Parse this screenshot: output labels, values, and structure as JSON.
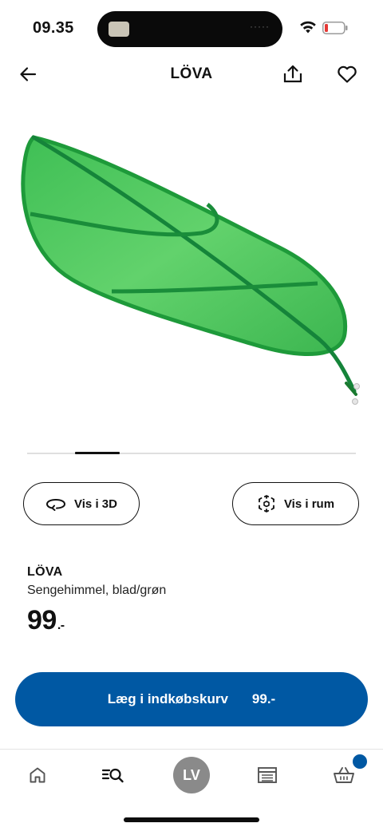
{
  "status_bar": {
    "time": "09.35",
    "icons": [
      "wifi-icon",
      "battery-icon"
    ],
    "battery_color": "#e53935"
  },
  "header": {
    "title": "LÖVA",
    "icons": [
      "arrow-left-icon",
      "share-icon",
      "heart-icon"
    ]
  },
  "product_image": {
    "subject": "green leaf bed canopy",
    "colors": {
      "leaf_light": "#4cc35a",
      "leaf_dark": "#1e9a3a"
    }
  },
  "carousel": {
    "active_index": 1
  },
  "actions": {
    "view_3d_label": "Vis i 3D",
    "view_room_label": "Vis i rum",
    "view_3d_icon": "rotate-3d-icon",
    "view_room_icon": "ar-cube-icon"
  },
  "product": {
    "name": "LÖVA",
    "description": "Sengehimmel, blad/grøn",
    "price_main": "99",
    "price_suffix": ".-"
  },
  "cart_button": {
    "label": "Læg i indkøbskurv",
    "price": "99.-",
    "color": "#0058a3"
  },
  "bottom_nav": {
    "items": [
      "home-icon",
      "search-list-icon",
      "profile-avatar",
      "store-icon",
      "basket-icon"
    ],
    "profile_initials": "LV",
    "badge_color": "#0058a3"
  }
}
